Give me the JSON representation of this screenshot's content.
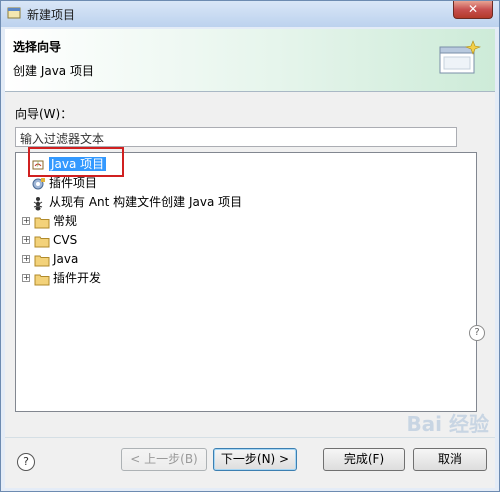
{
  "window": {
    "title": "新建项目",
    "close_label": "✕"
  },
  "header": {
    "title": "选择向导",
    "subtitle": "创建 Java 项目",
    "icon": "new-wizard-icon"
  },
  "wizard": {
    "label": "向导(W)：",
    "filter_value": "输入过滤器文本",
    "tree": [
      {
        "label": "Java 项目",
        "icon": "java-project-icon",
        "selected": true,
        "expandable": false
      },
      {
        "label": "插件项目",
        "icon": "plugin-project-icon",
        "selected": false,
        "expandable": false
      },
      {
        "label": "从现有 Ant 构建文件创建 Java 项目",
        "icon": "ant-icon",
        "selected": false,
        "expandable": false
      },
      {
        "label": "常规",
        "icon": "folder-icon",
        "selected": false,
        "expandable": true
      },
      {
        "label": "CVS",
        "icon": "folder-icon",
        "selected": false,
        "expandable": true
      },
      {
        "label": "Java",
        "icon": "folder-icon",
        "selected": false,
        "expandable": true
      },
      {
        "label": "插件开发",
        "icon": "folder-icon",
        "selected": false,
        "expandable": true
      }
    ]
  },
  "buttons": {
    "help": "?",
    "back": "< 上一步(B)",
    "next": "下一步(N) >",
    "finish": "完成(F)",
    "cancel": "取消"
  },
  "watermark": "Bai 经验",
  "colors": {
    "header_green": "#cdebd8",
    "selection": "#3399ff",
    "highlight_red": "#d02020",
    "close_red": "#c75050"
  }
}
